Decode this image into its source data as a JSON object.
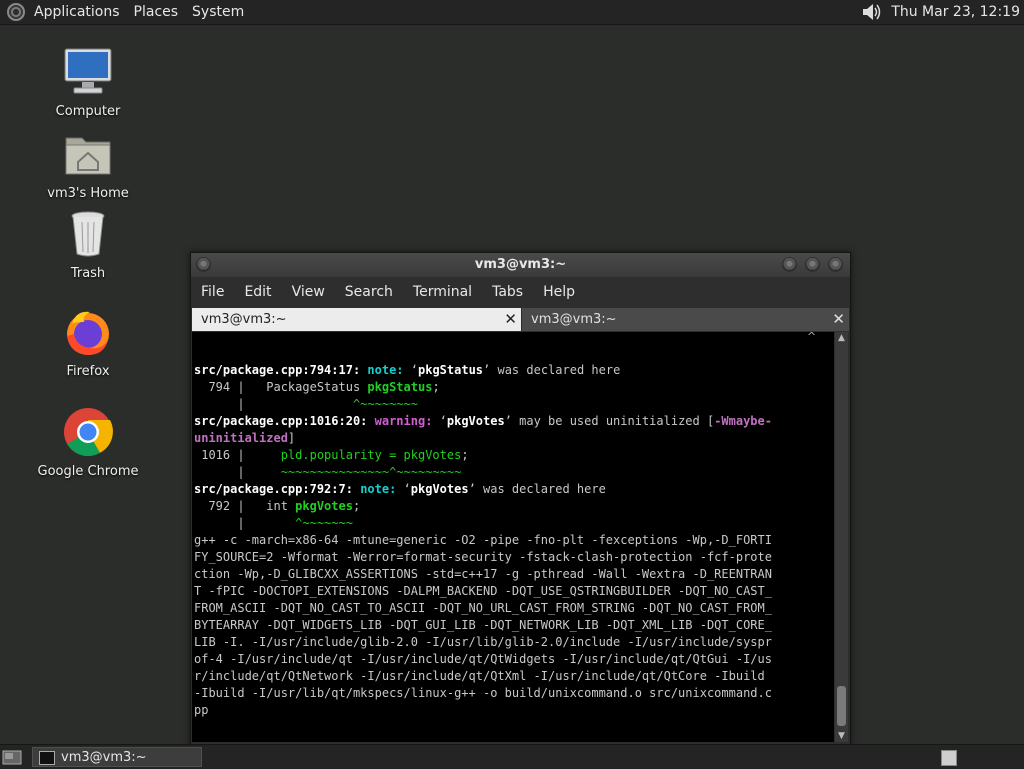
{
  "top_panel": {
    "menus": [
      "Applications",
      "Places",
      "System"
    ],
    "clock": "Thu Mar 23, 12:19"
  },
  "desktop_icons": [
    {
      "label": "Computer",
      "icon": "computer-icon"
    },
    {
      "label": "vm3's Home",
      "icon": "home-folder-icon"
    },
    {
      "label": "Trash",
      "icon": "trash-icon"
    },
    {
      "label": "Firefox",
      "icon": "firefox-icon"
    },
    {
      "label": "Google Chrome",
      "icon": "chrome-icon"
    }
  ],
  "terminal": {
    "title": "vm3@vm3:~",
    "menu": [
      "File",
      "Edit",
      "View",
      "Search",
      "Terminal",
      "Tabs",
      "Help"
    ],
    "tabs": [
      {
        "label": "vm3@vm3:~",
        "active": true
      },
      {
        "label": "vm3@vm3:~",
        "active": false
      }
    ],
    "lines": {
      "l1_loc": "src/package.cpp:794:17:",
      "l1_note": "note:",
      "l1_msg_a": "‘",
      "l1_var": "pkgStatus",
      "l1_msg_b": "’ was declared here",
      "l2_num": "  794 |   ",
      "l2_type": "PackageStatus ",
      "l2_var": "pkgStatus",
      "l2_end": ";",
      "l3_bar": "      |   ",
      "l3_caret": "            ^~~~~~~~~",
      "l4_loc": "src/package.cpp:1016:20:",
      "l4_warn": "warning:",
      "l4_msg_a": " ‘",
      "l4_var": "pkgVotes",
      "l4_msg_b": "’ may be used uninitialized [",
      "l4_flag": "-Wmaybe-",
      "l5_flag": "uninitialized",
      "l5_end": "]",
      "l6_num": " 1016 |     ",
      "l6_code": "pld.popularity = pkgVotes",
      "l6_end": ";",
      "l7_bar": "      |     ",
      "l7_caret": "~~~~~~~~~~~~~~~^~~~~~~~~~",
      "l8_loc": "src/package.cpp:792:7:",
      "l8_note": "note:",
      "l8_msg_a": " ‘",
      "l8_var": "pkgVotes",
      "l8_msg_b": "’ was declared here",
      "l9_num": "  792 |   ",
      "l9_type": "int ",
      "l9_var": "pkgVotes",
      "l9_end": ";",
      "l10_bar": "      |       ",
      "l10_caret": "^~~~~~~~",
      "compile_cmd": [
        "g++ -c -march=x86-64 -mtune=generic -O2 -pipe -fno-plt -fexceptions -Wp,-D_FORTI",
        "FY_SOURCE=2 -Wformat -Werror=format-security -fstack-clash-protection -fcf-prote",
        "ction -Wp,-D_GLIBCXX_ASSERTIONS -std=c++17 -g -pthread -Wall -Wextra -D_REENTRAN",
        "T -fPIC -DOCTOPI_EXTENSIONS -DALPM_BACKEND -DQT_USE_QSTRINGBUILDER -DQT_NO_CAST_",
        "FROM_ASCII -DQT_NO_CAST_TO_ASCII -DQT_NO_URL_CAST_FROM_STRING -DQT_NO_CAST_FROM_",
        "BYTEARRAY -DQT_WIDGETS_LIB -DQT_GUI_LIB -DQT_NETWORK_LIB -DQT_XML_LIB -DQT_CORE_",
        "LIB -I. -I/usr/include/glib-2.0 -I/usr/lib/glib-2.0/include -I/usr/include/syspr",
        "of-4 -I/usr/include/qt -I/usr/include/qt/QtWidgets -I/usr/include/qt/QtGui -I/us",
        "r/include/qt/QtNetwork -I/usr/include/qt/QtXml -I/usr/include/qt/QtCore -Ibuild",
        "-Ibuild -I/usr/lib/qt/mkspecs/linux-g++ -o build/unixcommand.o src/unixcommand.c",
        "pp"
      ]
    }
  },
  "taskbar": {
    "task_label": "vm3@vm3:~"
  }
}
